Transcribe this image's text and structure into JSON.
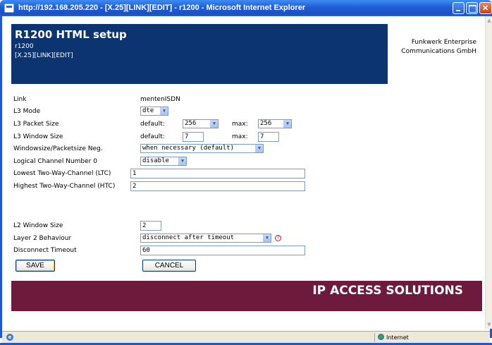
{
  "window": {
    "title": "http://192.168.205.220 - [X.25][LINK][EDIT] - r1200 - Microsoft Internet Explorer"
  },
  "header": {
    "title": "R1200 HTML setup",
    "device": "r1200",
    "path": "[X.25][LINK][EDIT]",
    "company_line1": "Funkwerk Enterprise",
    "company_line2": "Communications GmbH"
  },
  "form": {
    "link": {
      "label": "Link",
      "value": "mentenISDN"
    },
    "l3_mode": {
      "label": "L3 Mode",
      "value": "dte"
    },
    "l3_packet_size": {
      "label": "L3 Packet Size",
      "default_label": "default:",
      "default_value": "256",
      "max_label": "max:",
      "max_value": "256"
    },
    "l3_window_size": {
      "label": "L3 Window Size",
      "default_label": "default:",
      "default_value": "7",
      "max_label": "max:",
      "max_value": "7"
    },
    "window_packet_neg": {
      "label": "Windowsize/Packetsize Neg.",
      "value": "when necessary (default)"
    },
    "lcn0": {
      "label": "Logical Channel Number 0",
      "value": "disable"
    },
    "ltc": {
      "label": "Lowest Two-Way-Channel (LTC)",
      "value": "1"
    },
    "htc": {
      "label": "Highest Two-Way-Channel (HTC)",
      "value": "2"
    },
    "l2_window_size": {
      "label": "L2 Window Size",
      "value": "2"
    },
    "l2_behaviour": {
      "label": "Layer 2 Behaviour",
      "value": "disconnect after timeout"
    },
    "disconnect_timeout": {
      "label": "Disconnect Timeout",
      "value": "60"
    }
  },
  "buttons": {
    "save": "SAVE",
    "cancel": "CANCEL"
  },
  "banner": {
    "text": "IP ACCESS SOLUTIONS"
  },
  "statusbar": {
    "zone": "Internet"
  },
  "icons": {
    "help": "help-icon",
    "dropdown": "chevron-down-icon",
    "ie": "ie-icon",
    "globe": "globe-icon"
  }
}
